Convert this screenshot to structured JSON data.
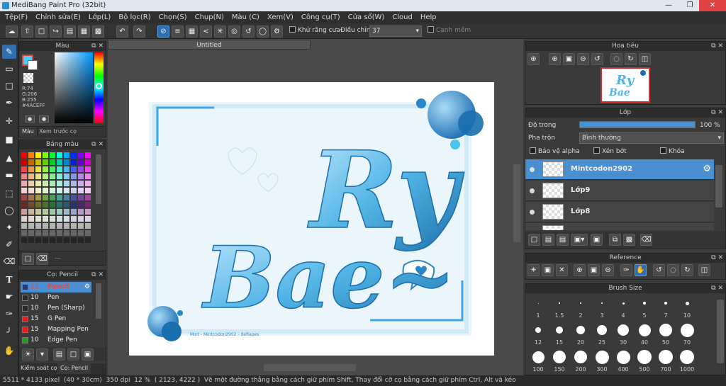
{
  "window": {
    "title": "MediBang Paint Pro (32bit)"
  },
  "menu": [
    "Tệp(F)",
    "Chỉnh sửa(E)",
    "Lớp(L)",
    "Bộ lọc(R)",
    "Chọn(S)",
    "Chụp(N)",
    "Màu (C)",
    "Xem(V)",
    "Công cụ(T)",
    "Cửa sổ(W)",
    "Cloud",
    "Help"
  ],
  "toolbar": {
    "antialias_label": "Khử răng cưa",
    "correction_label": "Điều chỉnh",
    "correction_value": "37",
    "sharp_label": "Cạnh mềm"
  },
  "color_panel": {
    "title": "Màu",
    "r": "R:74",
    "g": "G:206",
    "b": "B:255",
    "hex": "#4ACEFF",
    "tab_color": "Màu",
    "tab_preview": "Xem trước cọ",
    "foreground": "#4aceff"
  },
  "palette_panel": {
    "title": "Bảng màu",
    "footer_text": "---"
  },
  "brush_panel": {
    "title": "Cọ: Pencil",
    "brushes": [
      {
        "size": "12",
        "name": "Pencil",
        "color": "#1e3c78"
      },
      {
        "size": "10",
        "name": "Pen",
        "color": "#2a2a2a"
      },
      {
        "size": "10",
        "name": "Pen (Sharp)",
        "color": "#2a2a2a"
      },
      {
        "size": "15",
        "name": "G Pen",
        "color": "#e02020"
      },
      {
        "size": "15",
        "name": "Mapping Pen",
        "color": "#e02020"
      },
      {
        "size": "10",
        "name": "Edge Pen",
        "color": "#20a020"
      }
    ],
    "tab_control": "Kiểm soát cọ",
    "tab_brush": "Cọ: Pencil"
  },
  "document": {
    "tab_title": "Untitled"
  },
  "artwork": {
    "line1": "Ry",
    "line2": "Bae~",
    "signature": "Mint - Mintcodon2902 - deRapes"
  },
  "navigator": {
    "title": "Hoa tiêu"
  },
  "layer_panel": {
    "title": "Lớp",
    "opacity_label": "Độ trong",
    "opacity_value": "100 %",
    "blend_label": "Pha trộn",
    "blend_value": "Bình thường",
    "protect_alpha": "Bảo vệ alpha",
    "clipping": "Xén bớt",
    "lock": "Khóa",
    "layers": [
      "Mintcodon2902",
      "Lớp9",
      "Lớp8"
    ]
  },
  "reference_panel": {
    "title": "Reference"
  },
  "brush_size_panel": {
    "title": "Brush Size",
    "sizes": [
      "1",
      "1.5",
      "2",
      "3",
      "4",
      "5",
      "7",
      "10",
      "12",
      "15",
      "20",
      "25",
      "30",
      "40",
      "50",
      "70",
      "100",
      "150",
      "200",
      "300",
      "400",
      "500",
      "700",
      "1000"
    ]
  },
  "status": {
    "size": "5511 * 4133 pixel",
    "cm": "(40 * 30cm)",
    "dpi": "350 dpi",
    "zoom": "12 %",
    "coords": "( 2123, 4222 )",
    "hint": "Vẽ một đường thẳng bằng cách giữ phím Shift, Thay đổi cỡ cọ bằng cách giữ phím Ctrl, Alt và kéo"
  }
}
